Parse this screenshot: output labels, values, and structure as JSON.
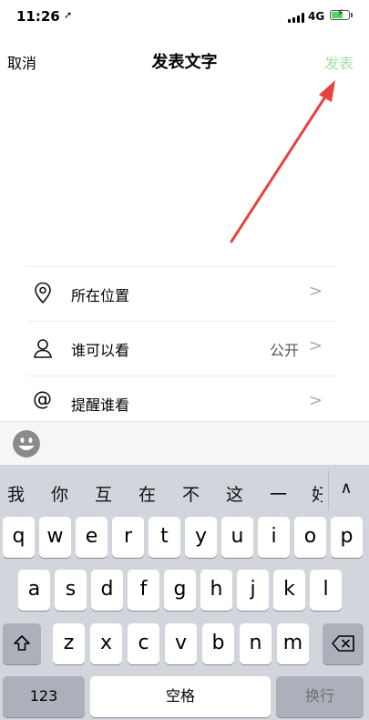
{
  "status": {
    "time": "11:26",
    "network": "4G"
  },
  "nav": {
    "cancel": "取消",
    "title": "发表文字",
    "post": "发表"
  },
  "options": [
    {
      "label": "所在位置",
      "value": "",
      "icon": "location-pin-icon"
    },
    {
      "label": "谁可以看",
      "value": "公开",
      "icon": "person-icon"
    },
    {
      "label": "提醒谁看",
      "value": "",
      "icon": "at-icon"
    }
  ],
  "keyboard": {
    "candidates": [
      "我",
      "你",
      "互",
      "在",
      "不",
      "这",
      "一",
      "好"
    ],
    "row1": [
      "q",
      "w",
      "e",
      "r",
      "t",
      "y",
      "u",
      "i",
      "o",
      "p"
    ],
    "row2": [
      "a",
      "s",
      "d",
      "f",
      "g",
      "h",
      "j",
      "k",
      "l"
    ],
    "row3": [
      "z",
      "x",
      "c",
      "v",
      "b",
      "n",
      "m"
    ],
    "numbers_key": "123",
    "space_key": "空格",
    "return_key": "换行"
  },
  "colors": {
    "post_disabled": "#a6dca9",
    "arrow": "#e8413f",
    "keyboard_bg": "#d2d5db"
  }
}
